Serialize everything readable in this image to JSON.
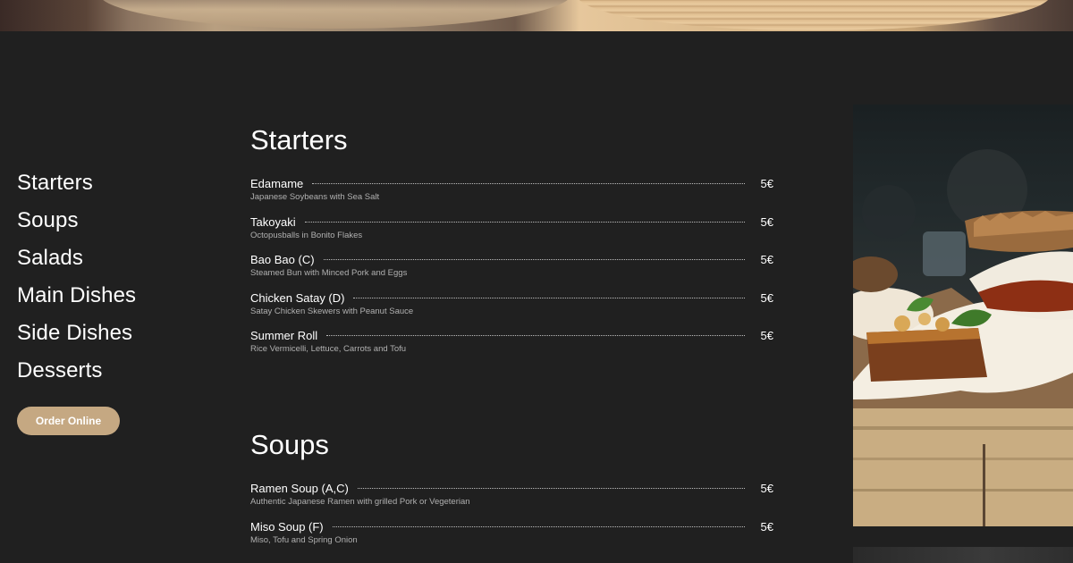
{
  "nav": {
    "items": [
      "Starters",
      "Soups",
      "Salads",
      "Main Dishes",
      "Side Dishes",
      "Desserts"
    ],
    "order_button": "Order Online"
  },
  "sections": [
    {
      "title": "Starters",
      "items": [
        {
          "name": "Edamame",
          "desc": "Japanese Soybeans with Sea Salt",
          "price": "5€"
        },
        {
          "name": "Takoyaki",
          "desc": "Octopusballs in Bonito Flakes",
          "price": "5€"
        },
        {
          "name": "Bao Bao (C)",
          "desc": "Steamed Bun with Minced Pork and Eggs",
          "price": "5€"
        },
        {
          "name": "Chicken Satay (D)",
          "desc": "Satay Chicken Skewers with Peanut Sauce",
          "price": "5€"
        },
        {
          "name": "Summer Roll",
          "desc": "Rice Vermicelli, Lettuce, Carrots and Tofu",
          "price": "5€"
        }
      ]
    },
    {
      "title": "Soups",
      "items": [
        {
          "name": "Ramen Soup (A,C)",
          "desc": "Authentic Japanese Ramen with grilled Pork or Vegeterian",
          "price": "5€"
        },
        {
          "name": "Miso Soup (F)",
          "desc": "Miso, Tofu and Spring Onion",
          "price": "5€"
        }
      ]
    }
  ],
  "colors": {
    "background": "#202020",
    "accent": "#c5a882",
    "text": "#ffffff",
    "muted": "#b0b0b0"
  }
}
